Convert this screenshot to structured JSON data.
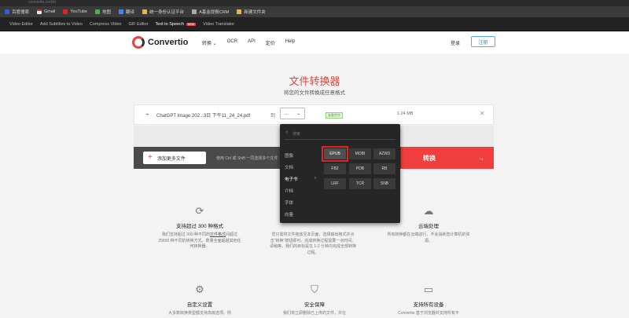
{
  "browser": {
    "url": "convertio.co/zh/",
    "bookmarks": [
      "百度搜索",
      "Gmail",
      "YouTube",
      "地图",
      "翻译",
      "统一身份认证平台",
      "A基金提报CRM",
      "新建文件夹"
    ],
    "toolbar_items": [
      "Video Editor",
      "Add Subtitles to Video",
      "Compress Video",
      "GIF Editor",
      "Text to Speech",
      "Video Translator"
    ],
    "new_badge": "NEW"
  },
  "header": {
    "brand": "Convertio",
    "nav": [
      "转换",
      "OCR",
      "API",
      "定价",
      "Help"
    ],
    "login": "登录",
    "signup": "注册"
  },
  "hero": {
    "title": "文件转换器",
    "subtitle": "将您的文件转换成任意格式"
  },
  "file": {
    "name": "ChatGPT Image 202...3日 下午11_24_24.pdf",
    "to_label": "到",
    "select_value": "...",
    "status": "准备完毕",
    "size": "1.24 MB"
  },
  "actions": {
    "add_more": "添加更多文件",
    "hint": "使用 Ctrl 或 Shift 一同选择多个文件",
    "convert": "转换"
  },
  "dropdown": {
    "search_placeholder": "搜索",
    "categories": [
      "图像",
      "文档",
      "电子书",
      "介档",
      "字体",
      "向量"
    ],
    "active_category": "电子书",
    "formats": [
      "EPUB",
      "MOBI",
      "AZW3",
      "FB2",
      "PDB",
      "RB",
      "LRF",
      "TCR",
      "SNB"
    ],
    "selected_format": "EPUB"
  },
  "features": [
    {
      "title": "支持超过 300 种格式",
      "desc1": "我们支持超过 300 种不同的",
      "link": "文件格式",
      "desc2": "间超过 25600 种不同的转换方式。数量全面超越其他任何转换器。"
    },
    {
      "title": "",
      "desc1": "您只需将文件拖放至本页面，选择输出格式并点击\"转换\"按钮即可。完成转换过程需要一点时间。请稍等。我们的目标是在 1-2 分钟内完成全部转换过程。",
      "link": "",
      "desc2": ""
    },
    {
      "title": "云端处理",
      "desc1": "所有转换都在云端进行，不会消耗您计算机的资源。",
      "link": "",
      "desc2": ""
    },
    {
      "title": "自定义设置",
      "desc1": "大多数转换类型都支持高级选项。例",
      "link": "",
      "desc2": ""
    },
    {
      "title": "安全保障",
      "desc1": "我们将立即删除已上传的文件，并在",
      "link": "",
      "desc2": ""
    },
    {
      "title": "支持所有设备",
      "desc1": "Convertio 基于浏览器并支持所有平",
      "link": "",
      "desc2": ""
    }
  ]
}
